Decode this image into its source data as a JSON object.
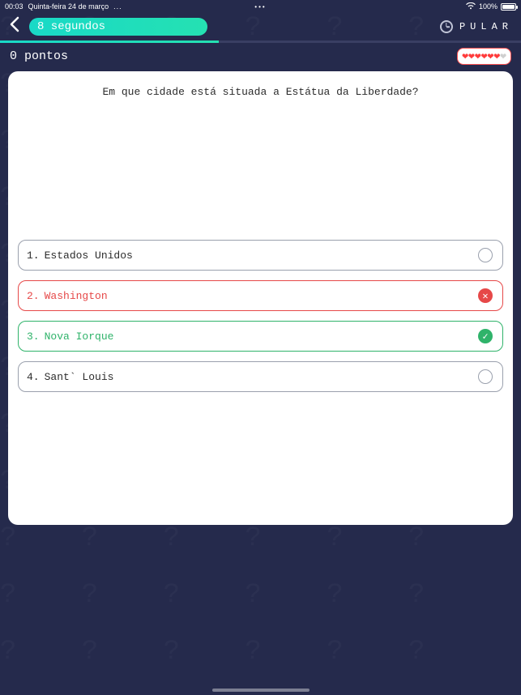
{
  "status": {
    "time": "00:03",
    "date": "Quinta-feira 24 de março",
    "dots": "•••",
    "battery_pct": "100%"
  },
  "topbar": {
    "timer_label": "8 segundos",
    "skip_label": "PULAR"
  },
  "progress": {
    "pct": 42
  },
  "score": {
    "text": "0 pontos"
  },
  "hearts": {
    "red": 6,
    "grey": 1
  },
  "question": "Em que cidade está situada a Estátua da Liberdade?",
  "answers": [
    {
      "num": "1.",
      "label": "Estados Unidos",
      "state": "neutral"
    },
    {
      "num": "2.",
      "label": "Washington",
      "state": "wrong"
    },
    {
      "num": "3.",
      "label": "Nova Iorque",
      "state": "correct"
    },
    {
      "num": "4.",
      "label": "Sant` Louis",
      "state": "neutral"
    }
  ],
  "colors": {
    "bg": "#252a4c",
    "accent": "#19d9c7",
    "correct": "#2fb36a",
    "wrong": "#e64848",
    "heart": "#ff3b3b"
  }
}
